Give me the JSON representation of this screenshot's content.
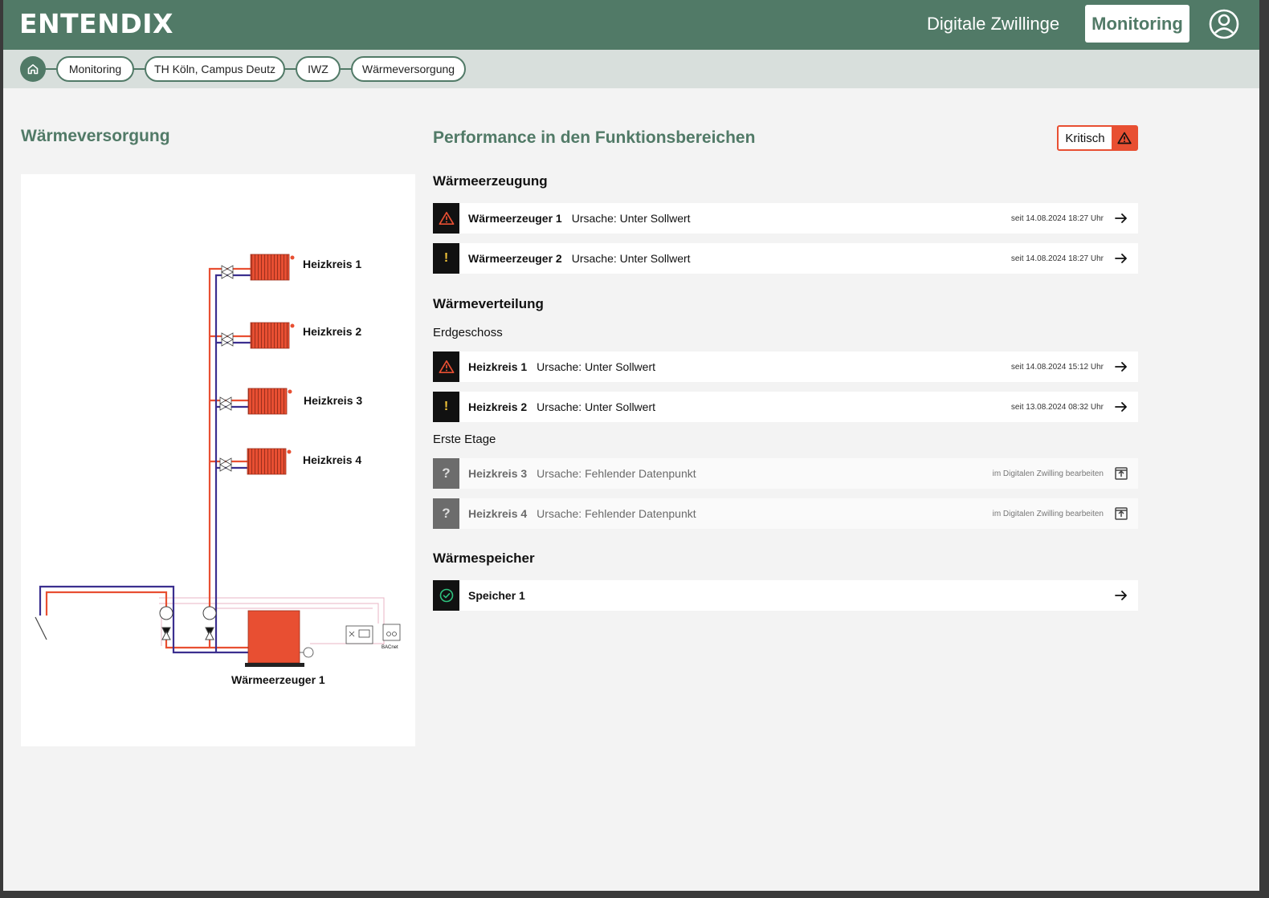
{
  "header": {
    "logo": "ENTENDIX",
    "nav_link": "Digitale Zwillinge",
    "nav_active": "Monitoring"
  },
  "breadcrumb": [
    "Monitoring",
    "TH Köln, Campus Deutz",
    "IWZ",
    "Wärmeversorgung"
  ],
  "left": {
    "title": "Wärmeversorgung",
    "diagram_labels": {
      "hk1": "Heizkreis 1",
      "hk2": "Heizkreis 2",
      "hk3": "Heizkreis 3",
      "hk4": "Heizkreis 4",
      "generator": "Wärmeerzeuger 1",
      "bacnet": "BACnet"
    }
  },
  "right": {
    "title": "Performance in den Funktionsbereichen",
    "status": "Kritisch",
    "sections": {
      "erzeugung": {
        "title": "Wärmeerzeugung",
        "rows": [
          {
            "name": "Wärmeerzeuger 1",
            "cause": "Ursache: Unter Sollwert",
            "time": "seit 14.08.2024 18:27 Uhr",
            "status": "critical"
          },
          {
            "name": "Wärmeerzeuger 2",
            "cause": "Ursache: Unter Sollwert",
            "time": "seit 14.08.2024 18:27 Uhr",
            "status": "warning"
          }
        ]
      },
      "verteilung": {
        "title": "Wärmeverteilung",
        "erdgeschoss": "Erdgeschoss",
        "erdgeschoss_rows": [
          {
            "name": "Heizkreis 1",
            "cause": "Ursache: Unter Sollwert",
            "time": "seit 14.08.2024 15:12 Uhr",
            "status": "critical"
          },
          {
            "name": "Heizkreis 2",
            "cause": "Ursache: Unter Sollwert",
            "time": "seit 13.08.2024 08:32 Uhr",
            "status": "warning"
          }
        ],
        "erste_etage": "Erste Etage",
        "erste_etage_rows": [
          {
            "name": "Heizkreis 3",
            "cause": "Ursache: Fehlender Datenpunkt",
            "time": "im Digitalen Zwilling bearbeiten",
            "status": "unknown"
          },
          {
            "name": "Heizkreis 4",
            "cause": "Ursache: Fehlender Datenpunkt",
            "time": "im Digitalen Zwilling bearbeiten",
            "status": "unknown"
          }
        ]
      },
      "speicher": {
        "title": "Wärmespeicher",
        "rows": [
          {
            "name": "Speicher 1",
            "cause": "",
            "time": "",
            "status": "ok"
          }
        ]
      }
    }
  },
  "colors": {
    "brand": "#517a67",
    "critical": "#e84f32",
    "warning": "#f2c438",
    "ok": "#2ec27e",
    "supply_pipe": "#e84f32",
    "return_pipe": "#3b2f8f"
  }
}
